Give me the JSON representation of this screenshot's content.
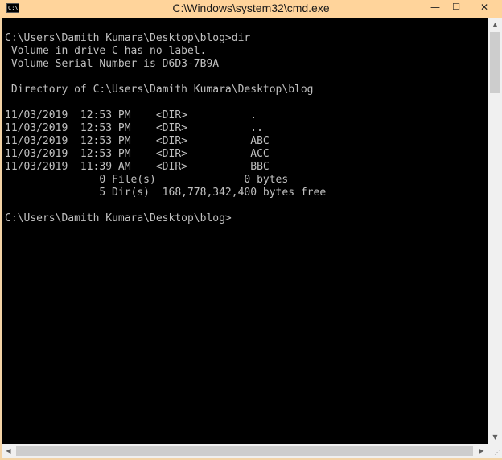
{
  "window": {
    "title": "C:\\Windows\\system32\\cmd.exe",
    "icon_name": "cmd-app-icon",
    "icon_text": "C:\\",
    "controls": {
      "minimize_glyph": "—",
      "maximize_glyph": "☐",
      "close_glyph": "✕"
    },
    "colors": {
      "titlebar": "#ffd49b",
      "console_bg": "#000000",
      "console_fg": "#c0c0c0"
    }
  },
  "console": {
    "lines": [
      "C:\\Users\\Damith Kumara\\Desktop\\blog>dir",
      " Volume in drive C has no label.",
      " Volume Serial Number is D6D3-7B9A",
      "",
      " Directory of C:\\Users\\Damith Kumara\\Desktop\\blog",
      "",
      "11/03/2019  12:53 PM    <DIR>          .",
      "11/03/2019  12:53 PM    <DIR>          ..",
      "11/03/2019  12:53 PM    <DIR>          ABC",
      "11/03/2019  12:53 PM    <DIR>          ACC",
      "11/03/2019  11:39 AM    <DIR>          BBC",
      "               0 File(s)              0 bytes",
      "               5 Dir(s)  168,778,342,400 bytes free",
      "",
      "C:\\Users\\Damith Kumara\\Desktop\\blog>"
    ]
  },
  "scrollbars": {
    "up_glyph": "▲",
    "down_glyph": "▼",
    "left_glyph": "◀",
    "right_glyph": "▶"
  }
}
